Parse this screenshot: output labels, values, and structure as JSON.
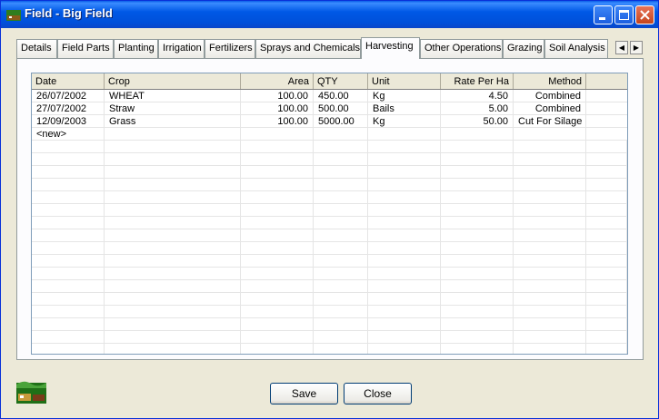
{
  "window": {
    "title": "Field - Big Field"
  },
  "tabs": [
    {
      "label": "Details"
    },
    {
      "label": "Field Parts"
    },
    {
      "label": "Planting"
    },
    {
      "label": "Irrigation"
    },
    {
      "label": "Fertilizers"
    },
    {
      "label": "Sprays and Chemicals"
    },
    {
      "label": "Harvesting",
      "active": true
    },
    {
      "label": "Other Operations"
    },
    {
      "label": "Grazing"
    },
    {
      "label": "Soil Analysis"
    }
  ],
  "grid": {
    "columns": [
      "Date",
      "Crop",
      "Area",
      "QTY",
      "Unit",
      "Rate Per Ha",
      "Method"
    ],
    "rows": [
      [
        "26/07/2002",
        "WHEAT",
        "100.00",
        "450.00",
        "Kg",
        "4.50",
        "Combined"
      ],
      [
        "27/07/2002",
        "Straw",
        "100.00",
        "500.00",
        "Bails",
        "5.00",
        "Combined"
      ],
      [
        "12/09/2003",
        "Grass",
        "100.00",
        "5000.00",
        "Kg",
        "50.00",
        "Cut For Silage"
      ],
      [
        "<new>",
        "",
        "",
        "",
        "",
        "",
        ""
      ]
    ]
  },
  "buttons": {
    "save": "Save",
    "close": "Close"
  },
  "icons": {
    "app": "field-icon",
    "tab_left": "arrow-left-icon",
    "tab_right": "arrow-right-icon"
  },
  "colors": {
    "titlebar": "#0058e6",
    "window_bg": "#ece9d8"
  }
}
